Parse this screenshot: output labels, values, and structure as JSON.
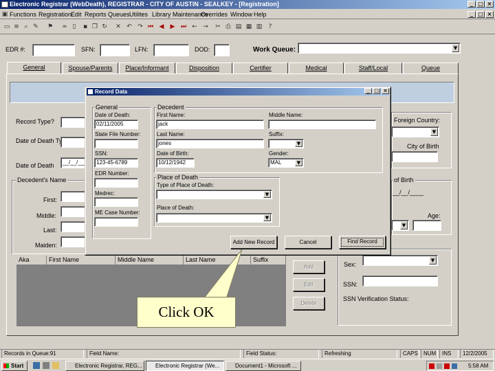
{
  "window": {
    "title": "Electronic Registrar (WebDeath), REGISTRAR - CITY OF AUSTIN - SEALKEY - [Registration]"
  },
  "menu": [
    "Functions",
    "Registration",
    "Edit",
    "Reports",
    "Queues",
    "Utilites",
    "Library Maintenance",
    "Overrides",
    "Window",
    "Help"
  ],
  "header": {
    "edr_label": "EDR #:",
    "sfn_label": "SFN:",
    "lfn_label": "LFN:",
    "dod_label": "DOD:",
    "work_queue_label": "Work Queue:"
  },
  "tabs": [
    "General",
    "Spouse/Parents",
    "Place/Informant",
    "Disposition",
    "Certifier",
    "Medical",
    "Staff/Local",
    "Queue"
  ],
  "form": {
    "record_type_label": "Record Type?",
    "date_of_death_type_label": "Date of Death Type:",
    "date_of_death_label": "Date of Death",
    "date_of_death_value": "__/__/____",
    "decedents_name_label": "Decedent's Name",
    "first_label": "First:",
    "middle_label": "Middle:",
    "last_label": "Last:",
    "maiden_label": "Maiden:",
    "foreign_country_label": "Foreign Country:",
    "city_of_birth_label": "City of Birth",
    "of_birth_label": "of Birth",
    "of_birth_value": "__/__/____",
    "age_label": "Age:",
    "sex_label": "Sex:",
    "ssn_label": "SSN:",
    "ssn_verification_label": "SSN Verification Status:"
  },
  "grid": {
    "columns": [
      "Aka",
      "First Name",
      "Middle Name",
      "Last Name",
      "Suffix"
    ]
  },
  "side_buttons": [
    "Add",
    "Edit",
    "Delete"
  ],
  "dialog": {
    "title": "Record Data",
    "general_title": "General",
    "date_of_death_label": "Date of Death:",
    "date_of_death_value": "02/11/2005",
    "state_file_label": "State File Number:",
    "ssn_label": "SSN:",
    "ssn_value": "123-45-6789",
    "edr_label": "EDR Number:",
    "medrec_label": "Medrec:",
    "mfcase_label": "ME Case Number:",
    "decedent_title": "Decedent",
    "first_name_label": "First Name:",
    "first_name_value": "jack",
    "middle_name_label": "Middle Name:",
    "last_name_label": "Last Name:",
    "last_name_value": "jones",
    "suffix_label": "Suffix:",
    "dob_label": "Date of Birth:",
    "dob_value": "10/12/1942",
    "gender_label": "Gender:",
    "gender_value": "MAL",
    "place_title": "Place of Death",
    "type_place_label": "Type of Place of Death:",
    "place_label": "Place of Death:",
    "add_new_label": "Add New Record",
    "cancel_label": "Cancel",
    "find_label": "Find Record"
  },
  "callout": {
    "text": "Click OK"
  },
  "status": {
    "records": "Records in Queue:91",
    "field_name": "Field Name:",
    "field_status": "Field Status:",
    "refreshing": "Refreshing",
    "caps": "CAPS",
    "num": "NUM",
    "ins": "INS",
    "date": "12/2/2005"
  },
  "taskbar": {
    "start": "Start",
    "tasks": [
      "Electronic Registrar, REG...",
      "Electronic Registrar (We...",
      "Document1 - Microsoft ..."
    ],
    "clock": "5:58 AM"
  }
}
